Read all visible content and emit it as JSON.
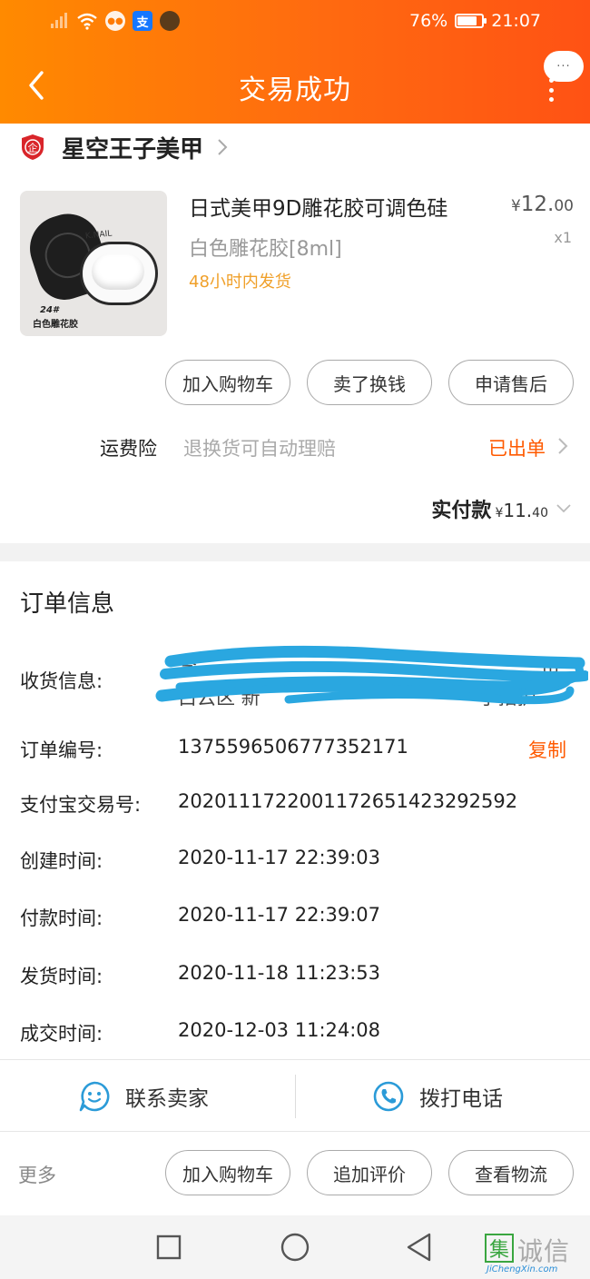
{
  "status_bar": {
    "battery": "76%",
    "time": "21:07"
  },
  "header": {
    "title": "交易成功",
    "more_bubble": "···"
  },
  "shop": {
    "name": "星空王子美甲",
    "badge_text": "企"
  },
  "product": {
    "title": "日式美甲9D雕花胶可调色硅",
    "price_currency": "¥",
    "price_int": "12.",
    "price_dec": "00",
    "sku": "白色雕花胶[8ml]",
    "qty": "x1",
    "shipping_note": "48小时内发货",
    "thumb_code": "24#",
    "thumb_caption": "白色雕花胶",
    "thumb_brand": "K.NAIL"
  },
  "actions_top": [
    "加入购物车",
    "卖了换钱",
    "申请售后"
  ],
  "insurance": {
    "label": "运费险",
    "desc": "退换货可自动理赔",
    "status": "已出单"
  },
  "paid": {
    "label": "实付款",
    "currency": "¥",
    "int": "11.",
    "dec": "40"
  },
  "order_info": {
    "title": "订单信息",
    "rows": [
      {
        "label": "收货信息:"
      },
      {
        "label": "订单编号:",
        "value": "1375596506777352171",
        "action": "复制"
      },
      {
        "label": "支付宝交易号:",
        "value": "2020111722001172651423292592"
      },
      {
        "label": "创建时间:",
        "value": "2020-11-17 22:39:03"
      },
      {
        "label": "付款时间:",
        "value": "2020-11-17 22:39:07"
      },
      {
        "label": "发货时间:",
        "value": "2020-11-18 11:23:53"
      },
      {
        "label": "成交时间:",
        "value": "2020-12-03 11:24:08"
      }
    ],
    "address_fragments": [
      "李",
      "市",
      "白云区 新",
      "一 手指护"
    ]
  },
  "contact": {
    "seller": "联系卖家",
    "phone": "拨打电话"
  },
  "bottom": {
    "more": "更多",
    "buttons": [
      "加入购物车",
      "追加评价",
      "查看物流"
    ]
  },
  "watermark": {
    "cn": "诚信",
    "box": "集",
    "en": "JiChengXin.com"
  },
  "colors": {
    "header_start": "#ff8a00",
    "header_end": "#ff5214",
    "accent": "#ff5a00",
    "ship_note": "#f0a02a",
    "contact_icon": "#2b9bd8",
    "scribble": "#2aa7e0"
  }
}
